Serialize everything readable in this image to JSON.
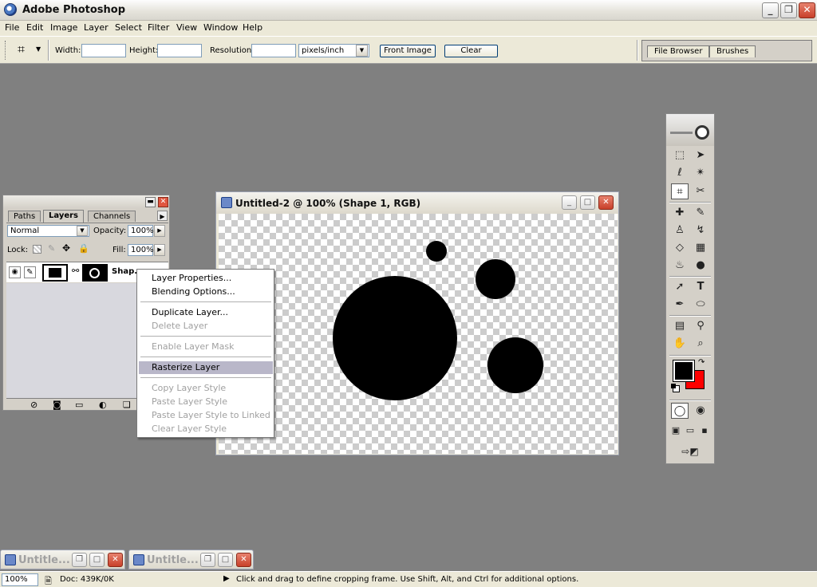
{
  "app": {
    "title": "Adobe Photoshop"
  },
  "menu": [
    "File",
    "Edit",
    "Image",
    "Layer",
    "Select",
    "Filter",
    "View",
    "Window",
    "Help"
  ],
  "options": {
    "width_label": "Width:",
    "height_label": "Height:",
    "resolution_label": "Resolution:",
    "resolution_unit": "pixels/inch",
    "front_image": "Front Image",
    "clear": "Clear",
    "palette_tabs": [
      "File Browser",
      "Brushes"
    ]
  },
  "layers_panel": {
    "tabs": [
      "Paths",
      "Layers",
      "Channels"
    ],
    "blend_mode": "Normal",
    "opacity_label": "Opacity:",
    "opacity_value": "100%",
    "lock_label": "Lock:",
    "fill_label": "Fill:",
    "fill_value": "100%",
    "layer_name": "Shap..."
  },
  "document": {
    "title": "Untitled-2 @ 100% (Shape 1, RGB)"
  },
  "context_menu": {
    "items": [
      {
        "label": "Layer Properties...",
        "enabled": true
      },
      {
        "label": "Blending Options...",
        "enabled": true
      },
      {
        "label": "Duplicate Layer...",
        "enabled": true
      },
      {
        "label": "Delete Layer",
        "enabled": false
      },
      {
        "label": "Enable Layer Mask",
        "enabled": false
      },
      {
        "label": "Rasterize Layer",
        "enabled": true,
        "highlighted": true
      },
      {
        "label": "Copy Layer Style",
        "enabled": false
      },
      {
        "label": "Paste Layer Style",
        "enabled": false
      },
      {
        "label": "Paste Layer Style to Linked",
        "enabled": false
      },
      {
        "label": "Clear Layer Style",
        "enabled": false
      }
    ]
  },
  "minimized_docs": [
    "Untitle...",
    "Untitle..."
  ],
  "status": {
    "zoom": "100%",
    "doc_info": "Doc: 439K/0K",
    "hint": "Click and drag to define cropping frame. Use Shift, Alt, and Ctrl for additional options."
  },
  "colors": {
    "foreground": "#000000",
    "background": "#ff0000"
  }
}
